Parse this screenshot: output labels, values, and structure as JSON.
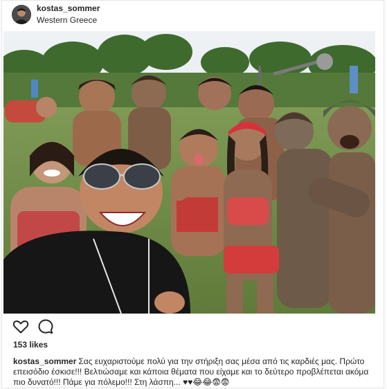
{
  "post": {
    "username": "kostas_sommer",
    "location": "Western Greece",
    "likes": "153 likes",
    "caption_user": "kostas_sommer",
    "caption_text": "Σας ευχαριστούμε πολύ για την στήριξη σας μέσα από τις καρδιές μας. Πρώτο επεισόδιο έσκισε!!! Βελτιώσαμε και κάποια θέματα που είχαμε και το δεύτερο προβλέπεται ακόμα πιο δυνατό!!! Πάμε για πόλεμο!!! Στη λάσπη... ♥♥😂😂😨😨"
  },
  "icons": {
    "like": "heart-icon",
    "comment": "comment-icon",
    "avatar": "user-avatar"
  },
  "colors": {
    "text": "#262626",
    "border": "#e6e6e6",
    "background": "#fafafa"
  }
}
